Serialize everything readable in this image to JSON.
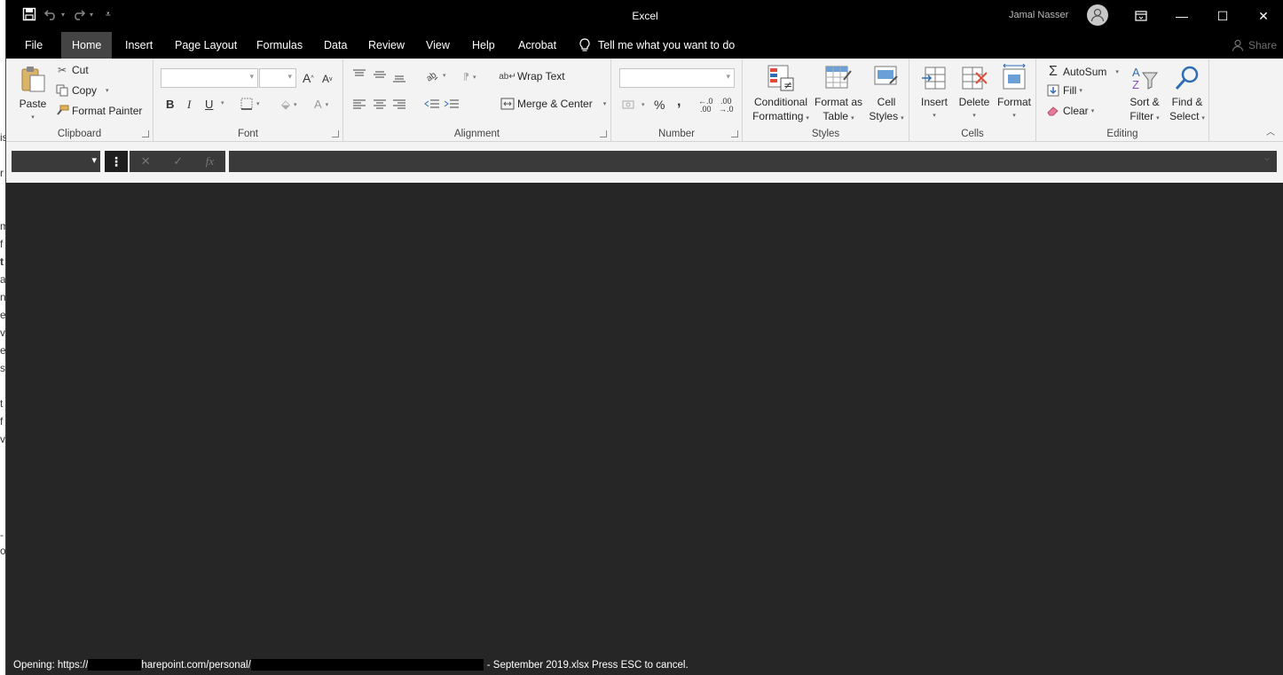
{
  "background_doc": {
    "fragments": [
      "is",
      "r",
      "m",
      "f",
      "t",
      "a",
      "n",
      "e",
      "v",
      "e",
      "s",
      "t",
      "f",
      "v",
      "-",
      "o"
    ]
  },
  "window": {
    "title": "Excel"
  },
  "qat": {
    "save": "save-icon",
    "undo": "undo-icon",
    "redo": "redo-icon",
    "customize": "customize-qat-icon"
  },
  "user": {
    "name": "Jamal Nasser"
  },
  "window_controls": {
    "ribbon_display": "ribbon-display-icon",
    "minimize": "—",
    "maximize": "☐",
    "close": "✕"
  },
  "tabs": [
    {
      "label": "File"
    },
    {
      "label": "Home"
    },
    {
      "label": "Insert"
    },
    {
      "label": "Page Layout"
    },
    {
      "label": "Formulas"
    },
    {
      "label": "Data"
    },
    {
      "label": "Review"
    },
    {
      "label": "View"
    },
    {
      "label": "Help"
    },
    {
      "label": "Acrobat"
    }
  ],
  "tell_me": "Tell me what you want to do",
  "share": "Share",
  "ribbon": {
    "clipboard": {
      "label": "Clipboard",
      "paste": "Paste",
      "cut": "Cut",
      "copy": "Copy",
      "format_painter": "Format Painter"
    },
    "font": {
      "label": "Font",
      "bold": "B",
      "italic": "I",
      "underline": "U"
    },
    "alignment": {
      "label": "Alignment",
      "wrap_text": "Wrap Text",
      "merge_center": "Merge & Center"
    },
    "number": {
      "label": "Number",
      "percent": "%",
      "comma": "̓"
    },
    "styles": {
      "label": "Styles",
      "conditional": [
        "Conditional",
        "Formatting"
      ],
      "format_table": [
        "Format as",
        "Table"
      ],
      "cell_styles": [
        "Cell",
        "Styles"
      ]
    },
    "cells": {
      "label": "Cells",
      "insert": "Insert",
      "delete": "Delete",
      "format": "Format"
    },
    "editing": {
      "label": "Editing",
      "autosum": "AutoSum",
      "fill": "Fill",
      "clear": "Clear",
      "sort_filter": [
        "Sort &",
        "Filter"
      ],
      "find_select": [
        "Find &",
        "Select"
      ]
    }
  },
  "formula_bar": {
    "cancel": "✕",
    "enter": "✓",
    "fx": "fx"
  },
  "status": {
    "prefix": "Opening: https://",
    "middle": "harepoint.com/personal/",
    "suffix": "- September 2019.xlsx Press ESC to cancel."
  },
  "colors": {
    "titlebar": "#000000",
    "ribbon": "#f3f3f3",
    "grid": "#262626",
    "active_tab": "#444444"
  }
}
